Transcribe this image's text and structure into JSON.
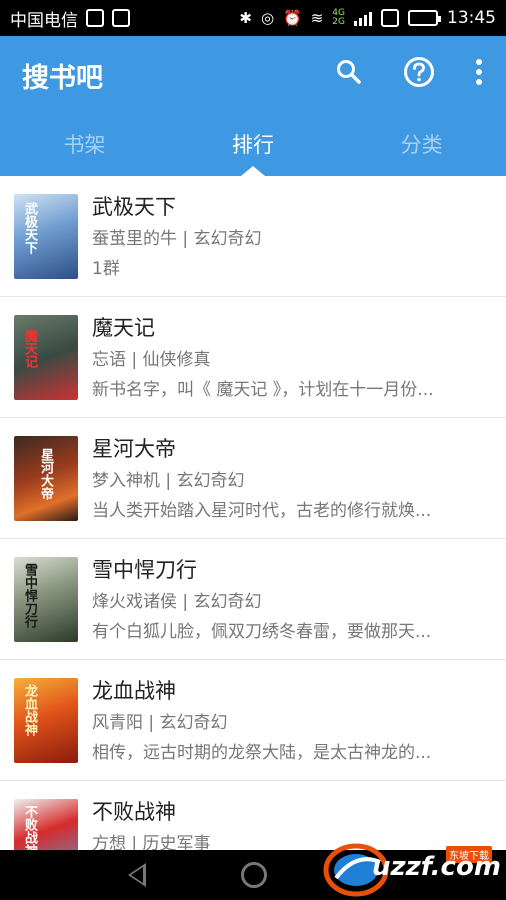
{
  "status_bar": {
    "carrier": "中国电信",
    "network_top": "4G",
    "network_bottom": "2G",
    "time": "13:45",
    "battery_level": 0.8
  },
  "app_bar": {
    "title": "搜书吧",
    "actions": [
      "search-icon",
      "help-icon",
      "more-vert-icon"
    ],
    "accent_color": "#3f98e2"
  },
  "tabs": [
    {
      "label": "书架",
      "active": false
    },
    {
      "label": "排行",
      "active": true
    },
    {
      "label": "分类",
      "active": false
    }
  ],
  "books": [
    {
      "title": "武极天下",
      "author": "蚕茧里的牛",
      "genre": "玄幻奇幻",
      "description": "1群",
      "cover_text": "武极天下"
    },
    {
      "title": "魔天记",
      "author": "忘语",
      "genre": "仙侠修真",
      "description": "新书名字，叫《 魔天记 》，计划在十一月份...",
      "cover_text": "魔天记"
    },
    {
      "title": "星河大帝",
      "author": "梦入神机",
      "genre": "玄幻奇幻",
      "description": "当人类开始踏入星河时代，古老的修行就焕...",
      "cover_text": "星河大帝"
    },
    {
      "title": "雪中悍刀行",
      "author": "烽火戏诸侯",
      "genre": "玄幻奇幻",
      "description": "有个白狐儿脸，佩双刀绣冬春雷，要做那天...",
      "cover_text": "雪中悍刀行"
    },
    {
      "title": "龙血战神",
      "author": "风青阳",
      "genre": "玄幻奇幻",
      "description": "相传，远古时期的龙祭大陆，是太古神龙的...",
      "cover_text": "龙血战神"
    },
    {
      "title": "不败战神",
      "author": "方想",
      "genre": "历史军事",
      "description": "",
      "cover_text": "不败战神"
    }
  ],
  "watermark": {
    "text": "uzzf.com",
    "tag": "东坡下载"
  }
}
